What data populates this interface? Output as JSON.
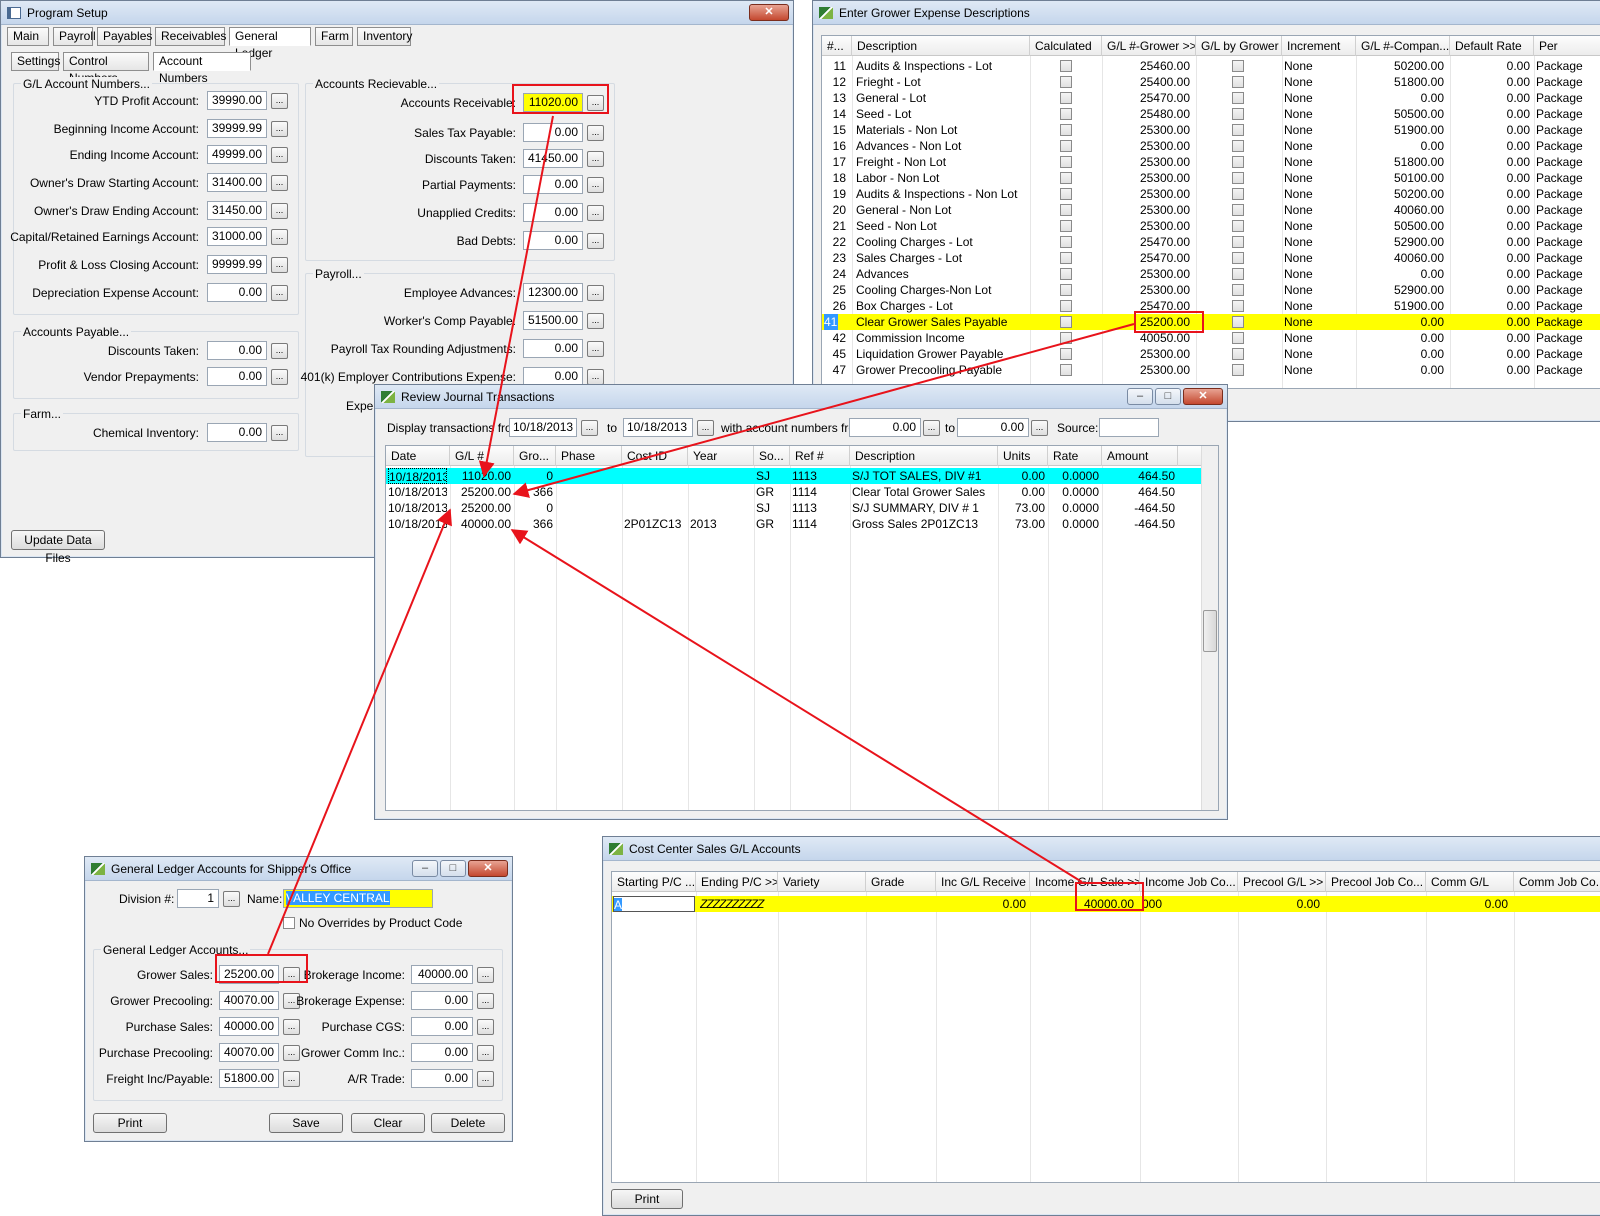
{
  "program_setup": {
    "title": "Program Setup",
    "tabs": [
      "Main",
      "Payroll",
      "Payables",
      "Receivables",
      "General Ledger",
      "Farm",
      "Inventory"
    ],
    "subtabs": [
      "Settings",
      "Control Numbers",
      "Account Numbers"
    ],
    "gl_group": "G/L Account Numbers...",
    "gl_fields": [
      {
        "label": "YTD Profit Account:",
        "value": "39990.00"
      },
      {
        "label": "Beginning Income Account:",
        "value": "39999.99"
      },
      {
        "label": "Ending Income Account:",
        "value": "49999.00"
      },
      {
        "label": "Owner's Draw Starting Account:",
        "value": "31400.00"
      },
      {
        "label": "Owner's Draw Ending Account:",
        "value": "31450.00"
      },
      {
        "label": "Capital/Retained Earnings Account:",
        "value": "31000.00"
      },
      {
        "label": "Profit & Loss Closing Account:",
        "value": "99999.99"
      },
      {
        "label": "Depreciation Expense Account:",
        "value": "0.00"
      }
    ],
    "ap_group": "Accounts Payable...",
    "ap_fields": [
      {
        "label": "Discounts Taken:",
        "value": "0.00"
      },
      {
        "label": "Vendor Prepayments:",
        "value": "0.00"
      }
    ],
    "farm_group": "Farm...",
    "farm_fields": [
      {
        "label": "Chemical Inventory:",
        "value": "0.00"
      }
    ],
    "ar_group": "Accounts Recievable...",
    "ar_fields": [
      {
        "label": "Accounts Receivable:",
        "value": "11020.00"
      },
      {
        "label": "Sales Tax Payable:",
        "value": "0.00"
      },
      {
        "label": "Discounts Taken:",
        "value": "41450.00"
      },
      {
        "label": "Partial Payments:",
        "value": "0.00"
      },
      {
        "label": "Unapplied Credits:",
        "value": "0.00"
      },
      {
        "label": "Bad Debts:",
        "value": "0.00"
      }
    ],
    "payroll_group": "Payroll...",
    "payroll_fields": [
      {
        "label": "Employee Advances:",
        "value": "12300.00"
      },
      {
        "label": "Worker's Comp Payable:",
        "value": "51500.00"
      },
      {
        "label": "Payroll Tax Rounding Adjustments:",
        "value": "0.00"
      },
      {
        "label": "401(k) Employer Contributions Expense:",
        "value": "0.00"
      }
    ],
    "payroll_cut_label": "Expe",
    "update_button": "Update Data Files"
  },
  "grower_expense": {
    "title": "Enter Grower Expense Descriptions",
    "columns": [
      "#...",
      "Description",
      "Calculated",
      "G/L #-Grower >>",
      "G/L by Grower",
      "Increment",
      "G/L #-Compan...",
      "Default Rate",
      "Per"
    ],
    "rows": [
      {
        "num": "11",
        "desc": "Audits & Inspections - Lot",
        "gl_grower": "25460.00",
        "increment": "None",
        "gl_company": "50200.00",
        "rate": "0.00",
        "per": "Package"
      },
      {
        "num": "12",
        "desc": "Frieght - Lot",
        "gl_grower": "25400.00",
        "increment": "None",
        "gl_company": "51800.00",
        "rate": "0.00",
        "per": "Package"
      },
      {
        "num": "13",
        "desc": "General - Lot",
        "gl_grower": "25470.00",
        "increment": "None",
        "gl_company": "0.00",
        "rate": "0.00",
        "per": "Package"
      },
      {
        "num": "14",
        "desc": "Seed - Lot",
        "gl_grower": "25480.00",
        "increment": "None",
        "gl_company": "50500.00",
        "rate": "0.00",
        "per": "Package"
      },
      {
        "num": "15",
        "desc": "Materials - Non Lot",
        "gl_grower": "25300.00",
        "increment": "None",
        "gl_company": "51900.00",
        "rate": "0.00",
        "per": "Package"
      },
      {
        "num": "16",
        "desc": "Advances - Non Lot",
        "gl_grower": "25300.00",
        "increment": "None",
        "gl_company": "0.00",
        "rate": "0.00",
        "per": "Package"
      },
      {
        "num": "17",
        "desc": "Freight - Non Lot",
        "gl_grower": "25300.00",
        "increment": "None",
        "gl_company": "51800.00",
        "rate": "0.00",
        "per": "Package"
      },
      {
        "num": "18",
        "desc": "Labor - Non Lot",
        "gl_grower": "25300.00",
        "increment": "None",
        "gl_company": "50100.00",
        "rate": "0.00",
        "per": "Package"
      },
      {
        "num": "19",
        "desc": "Audits & Inspections - Non Lot",
        "gl_grower": "25300.00",
        "increment": "None",
        "gl_company": "50200.00",
        "rate": "0.00",
        "per": "Package"
      },
      {
        "num": "20",
        "desc": "General - Non Lot",
        "gl_grower": "25300.00",
        "increment": "None",
        "gl_company": "40060.00",
        "rate": "0.00",
        "per": "Package"
      },
      {
        "num": "21",
        "desc": "Seed - Non Lot",
        "gl_grower": "25300.00",
        "increment": "None",
        "gl_company": "50500.00",
        "rate": "0.00",
        "per": "Package"
      },
      {
        "num": "22",
        "desc": "Cooling Charges - Lot",
        "gl_grower": "25470.00",
        "increment": "None",
        "gl_company": "52900.00",
        "rate": "0.00",
        "per": "Package"
      },
      {
        "num": "23",
        "desc": "Sales Charges - Lot",
        "gl_grower": "25470.00",
        "increment": "None",
        "gl_company": "40060.00",
        "rate": "0.00",
        "per": "Package"
      },
      {
        "num": "24",
        "desc": "Advances",
        "gl_grower": "25300.00",
        "increment": "None",
        "gl_company": "0.00",
        "rate": "0.00",
        "per": "Package"
      },
      {
        "num": "25",
        "desc": "Cooling Charges-Non Lot",
        "gl_grower": "25300.00",
        "increment": "None",
        "gl_company": "52900.00",
        "rate": "0.00",
        "per": "Package"
      },
      {
        "num": "26",
        "desc": "Box Charges - Lot",
        "gl_grower": "25470.00",
        "increment": "None",
        "gl_company": "51900.00",
        "rate": "0.00",
        "per": "Package"
      },
      {
        "num": "41",
        "desc": "Clear Grower Sales Payable",
        "gl_grower": "25200.00",
        "increment": "None",
        "gl_company": "0.00",
        "rate": "0.00",
        "per": "Package"
      },
      {
        "num": "42",
        "desc": "Commission Income",
        "gl_grower": "40050.00",
        "increment": "None",
        "gl_company": "0.00",
        "rate": "0.00",
        "per": "Package"
      },
      {
        "num": "45",
        "desc": "Liquidation Grower Payable",
        "gl_grower": "25300.00",
        "increment": "None",
        "gl_company": "0.00",
        "rate": "0.00",
        "per": "Package"
      },
      {
        "num": "47",
        "desc": "Grower Precooling Payable",
        "gl_grower": "25300.00",
        "increment": "None",
        "gl_company": "0.00",
        "rate": "0.00",
        "per": "Package"
      }
    ]
  },
  "journal": {
    "title": "Review Journal Transactions",
    "display_from_label": "Display transactions from:",
    "date_from": "10/18/2013",
    "to_label": "to",
    "date_to": "10/18/2013",
    "account_from_label": "with account numbers from:",
    "acct_from": "0.00",
    "acct_to": "0.00",
    "source_label": "Source:",
    "source_value": "",
    "columns": [
      "Date",
      "G/L #",
      "Gro...",
      "Phase",
      "Cost ID",
      "Year",
      "So...",
      "Ref #",
      "Description",
      "Units",
      "Rate",
      "Amount"
    ],
    "rows": [
      {
        "date": "10/18/2013",
        "gl": "11020.00",
        "gro": "0",
        "phase": "",
        "cost": "",
        "year": "",
        "so": "SJ",
        "ref": "1113",
        "desc": "S/J TOT SALES, DIV #1",
        "units": "0.00",
        "rate": "0.0000",
        "amount": "464.50"
      },
      {
        "date": "10/18/2013",
        "gl": "25200.00",
        "gro": "366",
        "phase": "",
        "cost": "",
        "year": "",
        "so": "GR",
        "ref": "1114",
        "desc": "Clear Total Grower Sales",
        "units": "0.00",
        "rate": "0.0000",
        "amount": "464.50"
      },
      {
        "date": "10/18/2013",
        "gl": "25200.00",
        "gro": "0",
        "phase": "",
        "cost": "",
        "year": "",
        "so": "SJ",
        "ref": "1113",
        "desc": "S/J SUMMARY, DIV # 1",
        "units": "73.00",
        "rate": "0.0000",
        "amount": "-464.50"
      },
      {
        "date": "10/18/2013",
        "gl": "40000.00",
        "gro": "366",
        "phase": "",
        "cost": "2P01ZC13",
        "year": "2013",
        "so": "GR",
        "ref": "1114",
        "desc": "Gross Sales 2P01ZC13",
        "units": "73.00",
        "rate": "0.0000",
        "amount": "-464.50"
      }
    ]
  },
  "shipper": {
    "title": "General Ledger Accounts for Shipper's Office",
    "division_label": "Division #:",
    "division_value": "1",
    "name_label": "Name:",
    "name_value": "VALLEY CENTRAL",
    "no_override_label": "No Overrides by Product Code",
    "group_title": "General Ledger Accounts...",
    "left_fields": [
      {
        "label": "Grower Sales:",
        "value": "25200.00"
      },
      {
        "label": "Grower Precooling:",
        "value": "40070.00"
      },
      {
        "label": "Purchase Sales:",
        "value": "40000.00"
      },
      {
        "label": "Purchase Precooling:",
        "value": "40070.00"
      },
      {
        "label": "Freight Inc/Payable:",
        "value": "51800.00"
      }
    ],
    "right_fields": [
      {
        "label": "Brokerage Income:",
        "value": "40000.00"
      },
      {
        "label": "Brokerage Expense:",
        "value": "0.00"
      },
      {
        "label": "Purchase CGS:",
        "value": "0.00"
      },
      {
        "label": "Grower Comm Inc.:",
        "value": "0.00"
      },
      {
        "label": "A/R Trade:",
        "value": "0.00"
      }
    ],
    "buttons": [
      "Print",
      "Save",
      "Clear",
      "Delete"
    ]
  },
  "cost_center": {
    "title": "Cost Center Sales G/L Accounts",
    "columns": [
      "Starting P/C ...",
      "Ending P/C >>",
      "Variety",
      "Grade",
      "Inc G/L Receive",
      "Income G/L Sale >>",
      "Income Job Co...",
      "Precool G/L >>",
      "Precool Job Co...",
      "Comm G/L",
      "Comm Job Co..."
    ],
    "row": {
      "start": "A",
      "end": "ZZZZZZZZZZ",
      "inc_receive": "0.00",
      "income_sale": "40000.00",
      "income_job": "000",
      "precool": "0.00",
      "comm": "0.00"
    },
    "print_button": "Print"
  },
  "colors": {
    "highlight": "#ffff00",
    "selection": "#00ffff",
    "annotation": "#e8131b"
  }
}
